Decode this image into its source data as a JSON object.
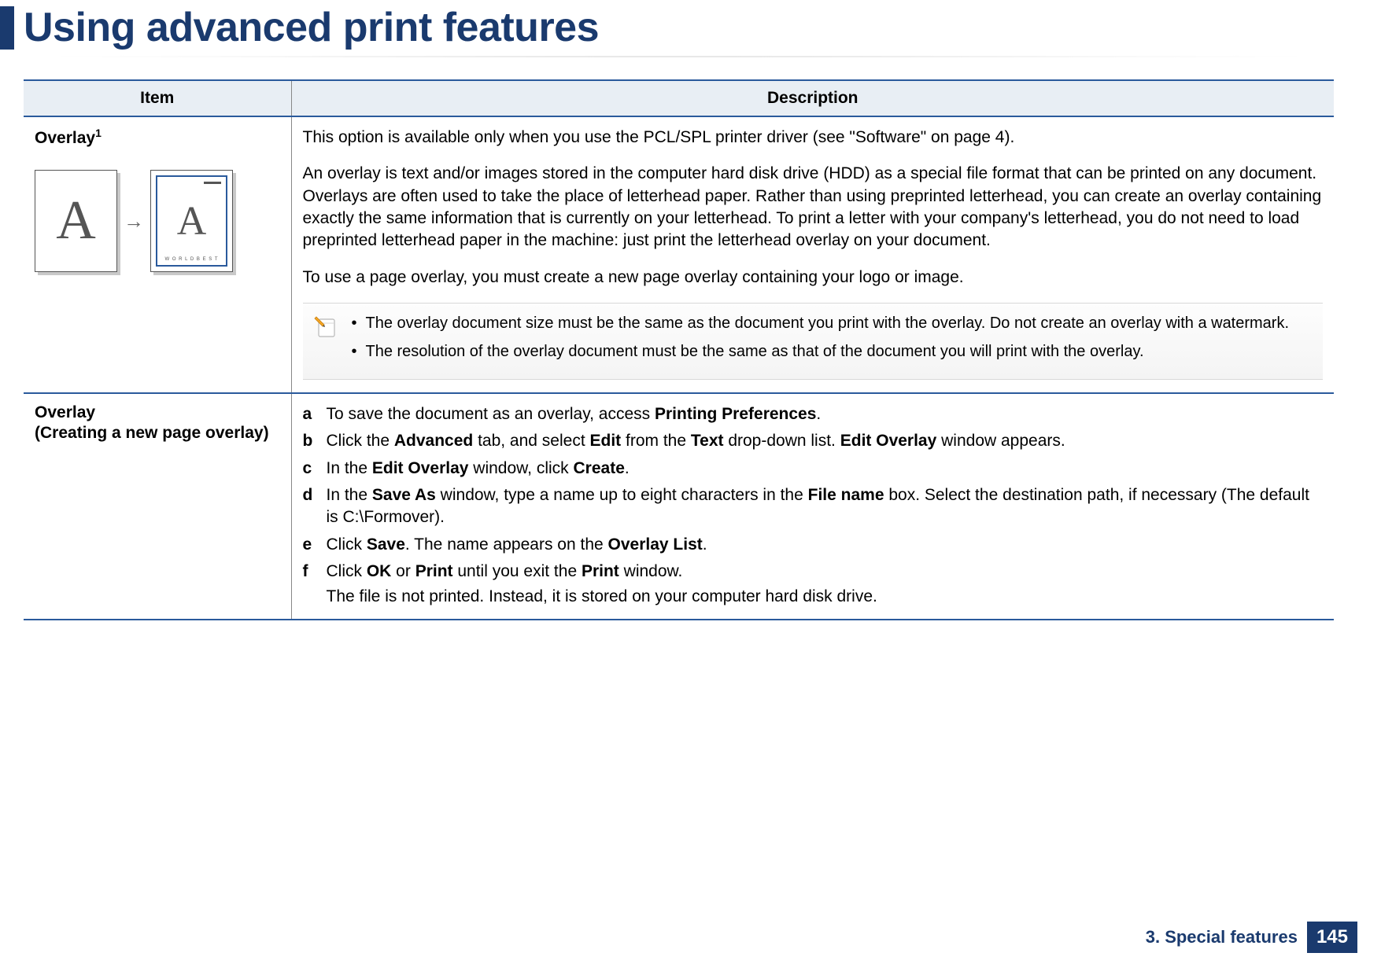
{
  "page_title": "Using advanced print features",
  "table": {
    "headers": {
      "item": "Item",
      "description": "Description"
    },
    "rows": [
      {
        "item_label": "Overlay",
        "item_sup": "1",
        "figure_footer": "W O R L D  B E S T",
        "desc": {
          "p1": "This option is available only when you use the PCL/SPL printer driver (see \"Software\" on page 4).",
          "p2": "An overlay is text and/or images stored in the computer hard disk drive (HDD) as a special file format that can be printed on any document. Overlays are often used to take the place of letterhead paper. Rather than using preprinted letterhead, you can create an overlay containing exactly the same information that is currently on your letterhead. To print a letter with your company's letterhead, you do not need to load preprinted letterhead paper in the machine: just print the letterhead overlay on your document.",
          "p3": "To use a page overlay, you must create a new page overlay containing your logo or image."
        },
        "notes": [
          "The overlay document size must be the same as the document you print with the overlay. Do not create an overlay with a watermark.",
          "The resolution of the overlay document must be the same as that of the document you will print with the overlay."
        ]
      },
      {
        "item_label": "Overlay",
        "item_sub": "(Creating a new page overlay)",
        "steps": {
          "a_pre": "To save the document as an overlay, access ",
          "a_b1": "Printing Preferences",
          "a_post": ".",
          "b_pre": "Click the ",
          "b_b1": "Advanced",
          "b_mid1": " tab, and select ",
          "b_b2": "Edit",
          "b_mid2": " from the ",
          "b_b3": "Text",
          "b_mid3": " drop-down list. ",
          "b_b4": "Edit Overlay",
          "b_post": " window appears.",
          "c_pre": "In the ",
          "c_b1": "Edit Overlay",
          "c_mid": " window, click ",
          "c_b2": "Create",
          "c_post": ".",
          "d_pre": "In the ",
          "d_b1": "Save As",
          "d_mid1": " window, type a name up to eight characters in the ",
          "d_b2": "File name",
          "d_post": " box. Select the destination path, if necessary (The default is C:\\Formover).",
          "e_pre": "Click ",
          "e_b1": "Save",
          "e_mid": ". The name appears on the ",
          "e_b2": "Overlay List",
          "e_post": ".",
          "f_pre": "Click ",
          "f_b1": "OK",
          "f_mid1": " or ",
          "f_b2": "Print",
          "f_mid2": " until you exit the ",
          "f_b3": "Print",
          "f_post": " window.",
          "f_extra": "The file is not printed. Instead, it is stored on your computer hard disk drive."
        }
      }
    ]
  },
  "footer": {
    "chapter": "3. Special features",
    "page_number": "145"
  }
}
